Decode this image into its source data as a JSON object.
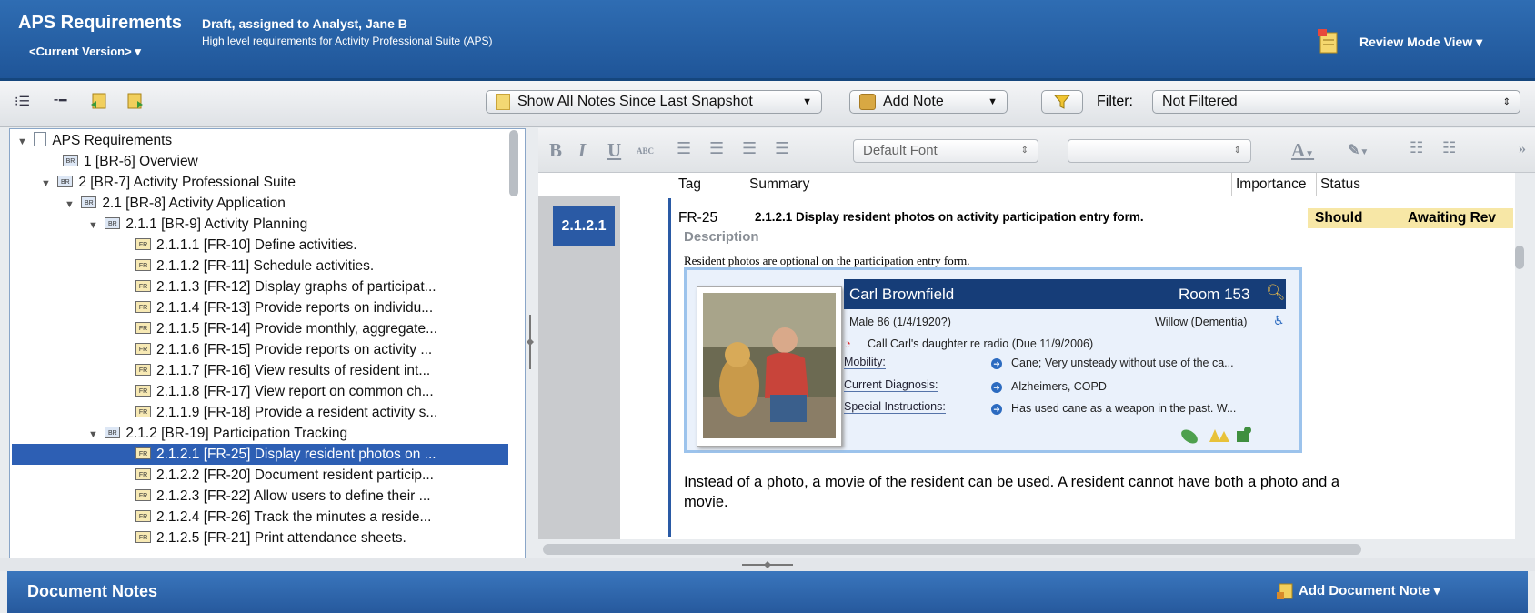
{
  "header": {
    "title": "APS Requirements",
    "version": "<Current Version> ▾",
    "status": "Draft, assigned to Analyst, Jane B",
    "description": "High level requirements for Activity Professional Suite (APS)",
    "review_mode": "Review Mode View ▾"
  },
  "toolbar": {
    "show_notes": "Show All Notes Since Last Snapshot",
    "add_note": "Add Note",
    "filter_label": "Filter:",
    "filter_value": "Not Filtered"
  },
  "tree": {
    "rows": [
      {
        "label": "APS Requirements"
      },
      {
        "label": "1 [BR-6] Overview"
      },
      {
        "label": "2 [BR-7] Activity Professional Suite"
      },
      {
        "label": "2.1 [BR-8] Activity Application"
      },
      {
        "label": "2.1.1 [BR-9] Activity Planning"
      },
      {
        "label": "2.1.1.1 [FR-10] Define activities."
      },
      {
        "label": "2.1.1.2 [FR-11] Schedule activities."
      },
      {
        "label": "2.1.1.3 [FR-12] Display graphs of participat..."
      },
      {
        "label": "2.1.1.4 [FR-13] Provide reports on individu..."
      },
      {
        "label": "2.1.1.5 [FR-14] Provide monthly, aggregate..."
      },
      {
        "label": "2.1.1.6 [FR-15] Provide reports on activity ..."
      },
      {
        "label": "2.1.1.7 [FR-16] View results of resident int..."
      },
      {
        "label": "2.1.1.8 [FR-17] View report on common ch..."
      },
      {
        "label": "2.1.1.9 [FR-18] Provide a resident activity s..."
      },
      {
        "label": "2.1.2 [BR-19] Participation Tracking"
      },
      {
        "label": "2.1.2.1 [FR-25] Display resident photos on ..."
      },
      {
        "label": "2.1.2.2 [FR-20] Document resident particip..."
      },
      {
        "label": "2.1.2.3 [FR-22] Allow users to define their ..."
      },
      {
        "label": "2.1.2.4 [FR-26] Track the minutes a reside..."
      },
      {
        "label": "2.1.2.5 [FR-21] Print attendance sheets."
      }
    ]
  },
  "editor": {
    "font_select": "Default Font",
    "col_tag": "Tag",
    "col_summary": "Summary",
    "col_importance": "Importance",
    "col_status": "Status"
  },
  "requirement": {
    "badge": "2.1.2.1",
    "tag": "FR-25",
    "summary": "2.1.2.1  Display resident photos on activity participation entry form.",
    "importance": "Should",
    "status": "Awaiting Rev",
    "description_label": "Description",
    "description_text": "Resident photos are optional on the participation entry form.",
    "body_text": "Instead of a photo, a movie of the resident can be used. A resident cannot have both a photo and a movie."
  },
  "card": {
    "name": "Carl Brownfield",
    "room": "Room 153",
    "demographics": "Male 86 (1/4/1920?)",
    "unit": "Willow (Dementia)",
    "reminder": "Call Carl's daughter re radio (Due 11/9/2006)",
    "mobility_label": "Mobility:",
    "mobility_value": "Cane; Very unsteady without use of the ca...",
    "diagnosis_label": "Current Diagnosis:",
    "diagnosis_value": "Alzheimers, COPD",
    "instructions_label": "Special Instructions:",
    "instructions_value": "Has used cane as a weapon in the past. W..."
  },
  "notes": {
    "title": "Document Notes",
    "add_label": "Add Document Note ▾"
  }
}
